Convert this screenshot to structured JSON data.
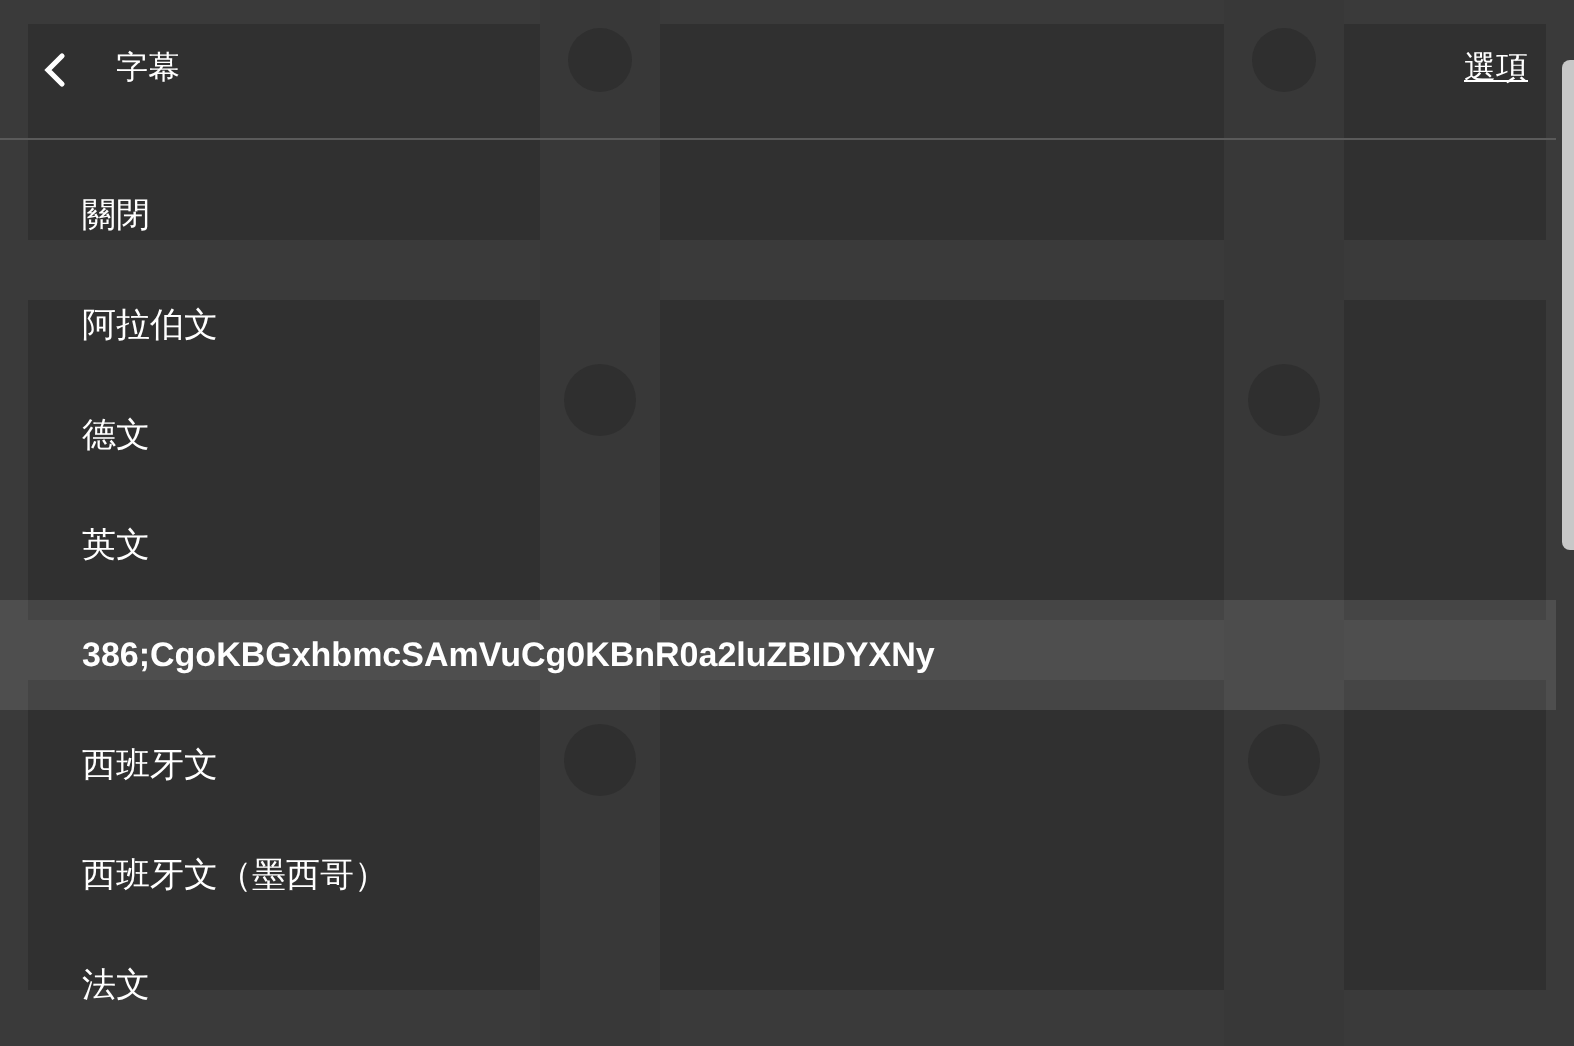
{
  "header": {
    "title": "字幕",
    "options_link": "選項"
  },
  "items": [
    {
      "label": "關閉",
      "selected": false
    },
    {
      "label": "阿拉伯文",
      "selected": false
    },
    {
      "label": "德文",
      "selected": false
    },
    {
      "label": "英文",
      "selected": false
    },
    {
      "label": "386;CgoKBGxhbmcSAmVuCg0KBnR0a2luZBIDYXNy",
      "selected": true
    },
    {
      "label": "西班牙文",
      "selected": false
    },
    {
      "label": "西班牙文（墨西哥）",
      "selected": false
    },
    {
      "label": "法文",
      "selected": false
    }
  ]
}
